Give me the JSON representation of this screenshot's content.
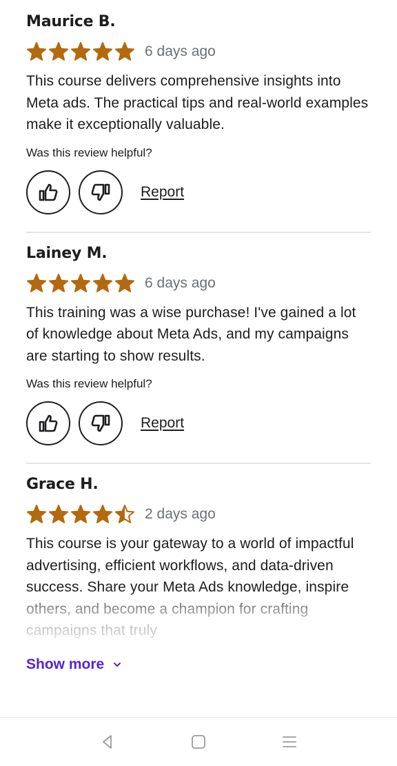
{
  "reviews": [
    {
      "name": "Maurice B.",
      "rating": 5,
      "date": "6 days ago",
      "text": "This course delivers comprehensive insights into Meta ads. The practical tips and real-world examples make it exceptionally valuable.",
      "helpful_prompt": "Was this review helpful?",
      "report_label": "Report"
    },
    {
      "name": "Lainey M.",
      "rating": 5,
      "date": "6 days ago",
      "text": "This training was a wise purchase! I've gained a lot of knowledge about Meta Ads, and my campaigns are starting to show results.",
      "helpful_prompt": "Was this review helpful?",
      "report_label": "Report"
    },
    {
      "name": "Grace H.",
      "rating": 4.5,
      "date": "2 days ago",
      "text": "This course is your gateway to a world of impactful advertising, efficient workflows, and data-driven success. Share your Meta Ads knowledge, inspire others, and become a champion for crafting campaigns that truly",
      "show_more_label": "Show more"
    }
  ],
  "colors": {
    "star": "#b4690e",
    "accent": "#5624d0",
    "text": "#1c1d1f",
    "muted": "#6a6f73"
  },
  "icons": {
    "like": "thumbs-up-icon",
    "dislike": "thumbs-down-icon",
    "show_more": "chevron-down-icon",
    "nav_back": "back-triangle-icon",
    "nav_home": "home-square-icon",
    "nav_menu": "menu-lines-icon"
  }
}
